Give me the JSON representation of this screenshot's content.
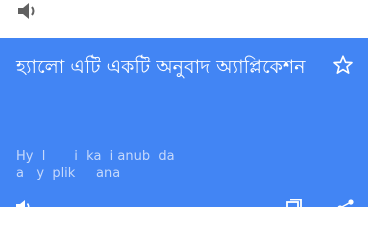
{
  "icons": {
    "top_speaker": "speaker-icon",
    "star": "star-icon",
    "bottom_speaker": "speaker-icon",
    "copy": "copy-icon",
    "share": "share-icon"
  },
  "colors": {
    "card_background": "#4285f4",
    "text_primary": "#ffffff",
    "text_secondary": "#c6d9fb"
  },
  "card": {
    "translated_text": "হ্যালো এটি একটি অনুবাদ অ্যাপ্লিকেশন",
    "transliteration": "Hy  l       i  ka  i anub  da\na   y  plik     ana"
  }
}
